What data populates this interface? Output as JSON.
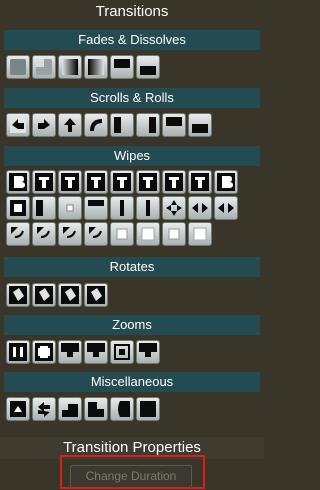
{
  "panel": {
    "title": "Transitions"
  },
  "sections": {
    "fades": {
      "title": "Fades & Dissolves",
      "icons": [
        "fade-icon",
        "dissolve-icon",
        "fade-from-black-icon",
        "fade-to-black-icon",
        "dip-icon",
        "cross-fade-icon"
      ]
    },
    "scrolls": {
      "title": "Scrolls & Rolls",
      "icons": [
        "scroll-left-icon",
        "scroll-right-icon",
        "roll-up-icon",
        "roll-down-icon",
        "slide-left-icon",
        "slide-right-icon",
        "slide-up-icon",
        "slide-down-icon"
      ]
    },
    "wipes": {
      "title": "Wipes",
      "icons": [
        "wipe-in-left-icon",
        "wipe-in-right-icon",
        "wipe-in-top-icon",
        "wipe-in-bottom-icon",
        "wipe-center-vertical-icon",
        "wipe-out-left-icon",
        "wipe-out-top-icon",
        "wipe-split-icon",
        "wipe-out-right-icon",
        "box-left-icon",
        "box-right-icon",
        "box-center-icon",
        "bar-down-icon",
        "bar-vertical-icon",
        "split-horizontal-icon",
        "split-vertical-icon",
        "arrows-in-icon",
        "arrows-out-icon",
        "curl-top-left-icon",
        "curl-top-right-icon",
        "curl-bottom-left-icon",
        "curl-bottom-right-icon",
        "iris-small-icon",
        "iris-medium-icon",
        "iris-large-icon",
        "iris-circle-icon"
      ]
    },
    "rotates": {
      "title": "Rotates",
      "icons": [
        "rotate-left-icon",
        "rotate-right-icon",
        "spin-left-icon",
        "spin-right-icon"
      ]
    },
    "zooms": {
      "title": "Zooms",
      "icons": [
        "zoom-corners-in-icon",
        "zoom-corners-out-icon",
        "zoom-top-icon",
        "zoom-bottom-icon",
        "zoom-center-icon",
        "zoom-grow-icon"
      ]
    },
    "misc": {
      "title": "Miscellaneous",
      "icons": [
        "flip-up-icon",
        "swap-icon",
        "stairs-left-icon",
        "stairs-right-icon",
        "page-turn-icon",
        "black-frame-icon"
      ]
    }
  },
  "properties": {
    "title": "Transition Properties",
    "change_duration_label": "Change Duration"
  },
  "colors": {
    "background": "#393529",
    "header": "#244a52",
    "highlight": "#d81e1e",
    "button_face": "#d3d8d8"
  }
}
